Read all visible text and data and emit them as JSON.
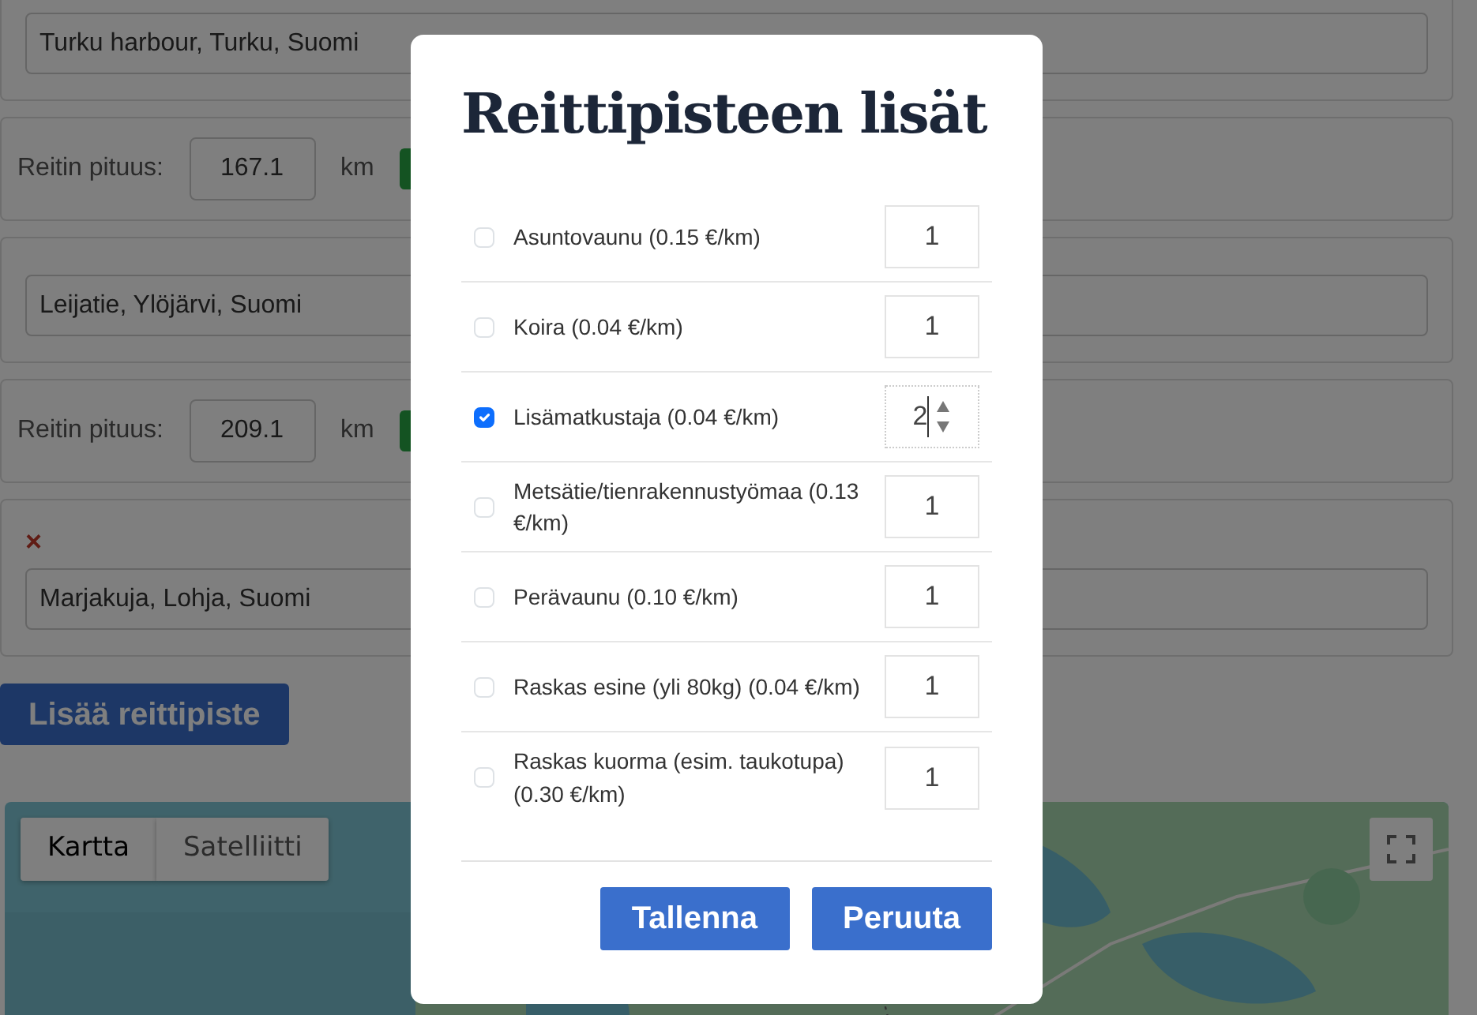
{
  "waypoints": [
    {
      "kind": "address",
      "address": "Turku harbour, Turku, Suomi",
      "removable": false
    },
    {
      "kind": "distance",
      "label": "Reitin pituus:",
      "value": "167.1",
      "unit": "km"
    },
    {
      "kind": "address",
      "address": "Leijatie, Ylöjärvi, Suomi",
      "removable": false
    },
    {
      "kind": "distance",
      "label": "Reitin pituus:",
      "value": "209.1",
      "unit": "km"
    },
    {
      "kind": "address",
      "address": "Marjakuja, Lohja, Suomi",
      "removable": true,
      "remove_icon": "×"
    }
  ],
  "add_button": "Lisää reittipiste",
  "map": {
    "kind": "picture",
    "types": [
      {
        "label": "Kartta",
        "selected": true
      },
      {
        "label": "Satelliitti",
        "selected": false
      }
    ]
  },
  "dialog": {
    "title": "Reittipisteen lisät",
    "extras": [
      {
        "label": "Asuntovaunu (0.15 €/km)",
        "checked": false,
        "quantity": "1",
        "focused": false
      },
      {
        "label": "Koira (0.04 €/km)",
        "checked": false,
        "quantity": "1",
        "focused": false
      },
      {
        "label": "Lisämatkustaja (0.04 €/km)",
        "checked": true,
        "quantity": "2",
        "focused": true
      },
      {
        "label": "Metsätie/tienrakennustyömaa (0.13 €/km)",
        "checked": false,
        "quantity": "1",
        "focused": false
      },
      {
        "label": "Perävaunu (0.10 €/km)",
        "checked": false,
        "quantity": "1",
        "focused": false
      },
      {
        "label": "Raskas esine (yli 80kg) (0.04 €/km)",
        "checked": false,
        "quantity": "1",
        "focused": false
      },
      {
        "label": "Raskas kuorma (esim. taukotupa) (0.30 €/km)",
        "checked": false,
        "quantity": "1",
        "focused": false
      }
    ],
    "buttons": [
      "Tallenna",
      "Peruuta"
    ]
  }
}
